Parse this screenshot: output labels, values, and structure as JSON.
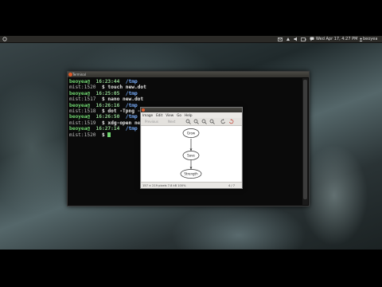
{
  "topbar": {
    "clock": "Wed Apr 17, 4:27 PM",
    "user": "beoyea",
    "indicators": [
      "mail-icon",
      "network-icon",
      "volume-icon",
      "battery-icon",
      "chat-icon"
    ]
  },
  "terminal": {
    "title": "Terminal",
    "lines": [
      {
        "user": "beoyea@",
        "host": "",
        "time": "16:23:44",
        "path": "/tmp",
        "cmd": ""
      },
      {
        "user": "",
        "host": "mist:1520",
        "time": "",
        "path": "",
        "cmd": "$ touch new.dot"
      },
      {
        "user": "beoyea@",
        "host": "",
        "time": "16:25:05",
        "path": "/tmp",
        "cmd": ""
      },
      {
        "user": "",
        "host": "mist:1517",
        "time": "",
        "path": "",
        "cmd": "$ nano new.dot"
      },
      {
        "user": "beoyea@",
        "host": "",
        "time": "16:26:16",
        "path": "/tmp",
        "cmd": ""
      },
      {
        "user": "",
        "host": "mist:1518",
        "time": "",
        "path": "",
        "cmd": "$ dot -Tpng -O new.dot"
      },
      {
        "user": "beoyea@",
        "host": "",
        "time": "16:26:50",
        "path": "/tmp",
        "cmd": ""
      },
      {
        "user": "",
        "host": "mist:1519",
        "time": "",
        "path": "",
        "cmd": "$ xdg-open ne"
      },
      {
        "user": "beoyea@",
        "host": "",
        "time": "16:27:14",
        "path": "/tmp",
        "cmd": ""
      },
      {
        "user": "",
        "host": "mist:1520",
        "time": "",
        "path": "",
        "cmd": "$ "
      }
    ]
  },
  "viewer": {
    "menus": [
      "Image",
      "Edit",
      "View",
      "Go",
      "Help"
    ],
    "toolbar": {
      "prev": "Previous",
      "next": "Next"
    },
    "graph": {
      "nodes": [
        "Grow",
        "Save",
        "Strength"
      ]
    },
    "status": {
      "dims": "157 × 219 pixels  7.8 kB  100%",
      "index": "4 / 7"
    }
  }
}
